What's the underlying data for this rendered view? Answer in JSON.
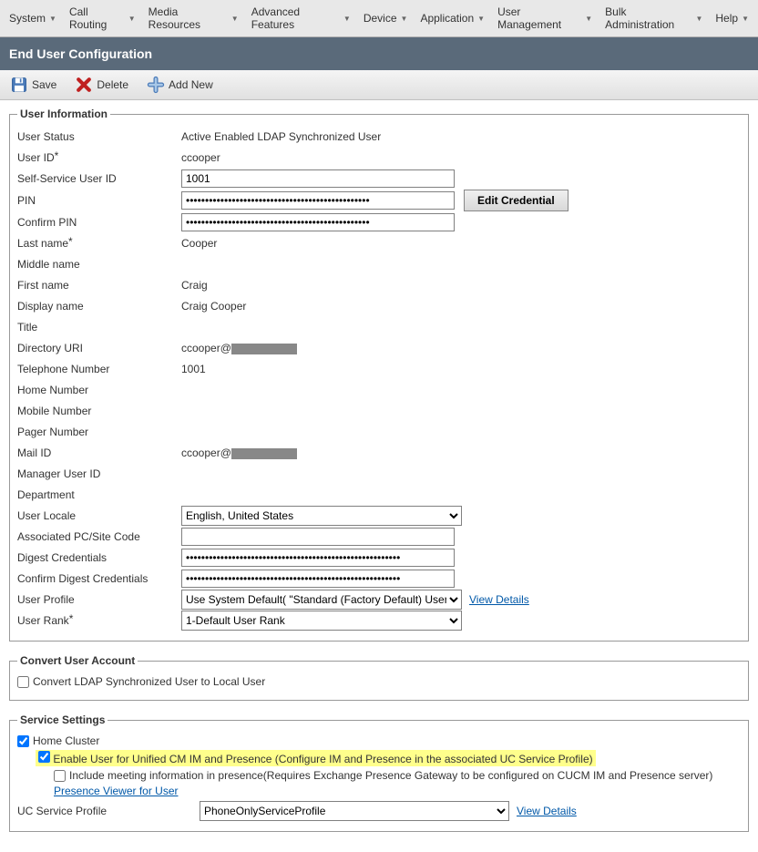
{
  "menubar": {
    "items": [
      "System",
      "Call Routing",
      "Media Resources",
      "Advanced Features",
      "Device",
      "Application",
      "User Management",
      "Bulk Administration",
      "Help"
    ]
  },
  "page_title": "End User Configuration",
  "toolbar": {
    "save": "Save",
    "delete": "Delete",
    "add_new": "Add New"
  },
  "user_info": {
    "legend": "User Information",
    "status_label": "User Status",
    "status_value": "Active Enabled LDAP Synchronized User",
    "user_id_label": "User ID",
    "user_id_value": "ccooper",
    "self_service_label": "Self-Service User ID",
    "self_service_value": "1001",
    "pin_label": "PIN",
    "pin_value": "••••••••••••••••••••••••••••••••••••••••••••••••",
    "edit_credential": "Edit Credential",
    "confirm_pin_label": "Confirm PIN",
    "confirm_pin_value": "••••••••••••••••••••••••••••••••••••••••••••••••",
    "last_name_label": "Last name",
    "last_name_value": "Cooper",
    "middle_name_label": "Middle name",
    "middle_name_value": "",
    "first_name_label": "First name",
    "first_name_value": "Craig",
    "display_name_label": "Display name",
    "display_name_value": "Craig Cooper",
    "title_label": "Title",
    "title_value": "",
    "directory_uri_label": "Directory URI",
    "directory_uri_value": "ccooper@",
    "telephone_label": "Telephone Number",
    "telephone_value": "1001",
    "home_number_label": "Home Number",
    "home_number_value": "",
    "mobile_number_label": "Mobile Number",
    "mobile_number_value": "",
    "pager_number_label": "Pager Number",
    "pager_number_value": "",
    "mail_id_label": "Mail ID",
    "mail_id_value": "ccooper@",
    "manager_label": "Manager User ID",
    "manager_value": "",
    "department_label": "Department",
    "department_value": "",
    "user_locale_label": "User Locale",
    "user_locale_value": "English, United States",
    "pc_site_label": "Associated PC/Site Code",
    "pc_site_value": "",
    "digest_label": "Digest Credentials",
    "digest_value": "••••••••••••••••••••••••••••••••••••••••••••••••••••••••",
    "confirm_digest_label": "Confirm Digest Credentials",
    "confirm_digest_value": "••••••••••••••••••••••••••••••••••••••••••••••••••••••••",
    "user_profile_label": "User Profile",
    "user_profile_value": "Use System Default( \"Standard (Factory Default) User Profile\" )",
    "view_details": "View Details",
    "user_rank_label": "User Rank",
    "user_rank_value": "1-Default User Rank"
  },
  "convert": {
    "legend": "Convert User Account",
    "checkbox_label": "Convert LDAP Synchronized User to Local User"
  },
  "service": {
    "legend": "Service Settings",
    "home_cluster": "Home Cluster",
    "enable_im": "Enable User for Unified CM IM and Presence (Configure IM and Presence in the associated UC Service Profile)",
    "include_meeting": "Include meeting information in presence(Requires Exchange Presence Gateway to be configured on CUCM IM and Presence server)",
    "presence_viewer": "Presence Viewer for User",
    "uc_profile_label": "UC Service Profile",
    "uc_profile_value": "PhoneOnlyServiceProfile",
    "view_details": "View Details"
  }
}
